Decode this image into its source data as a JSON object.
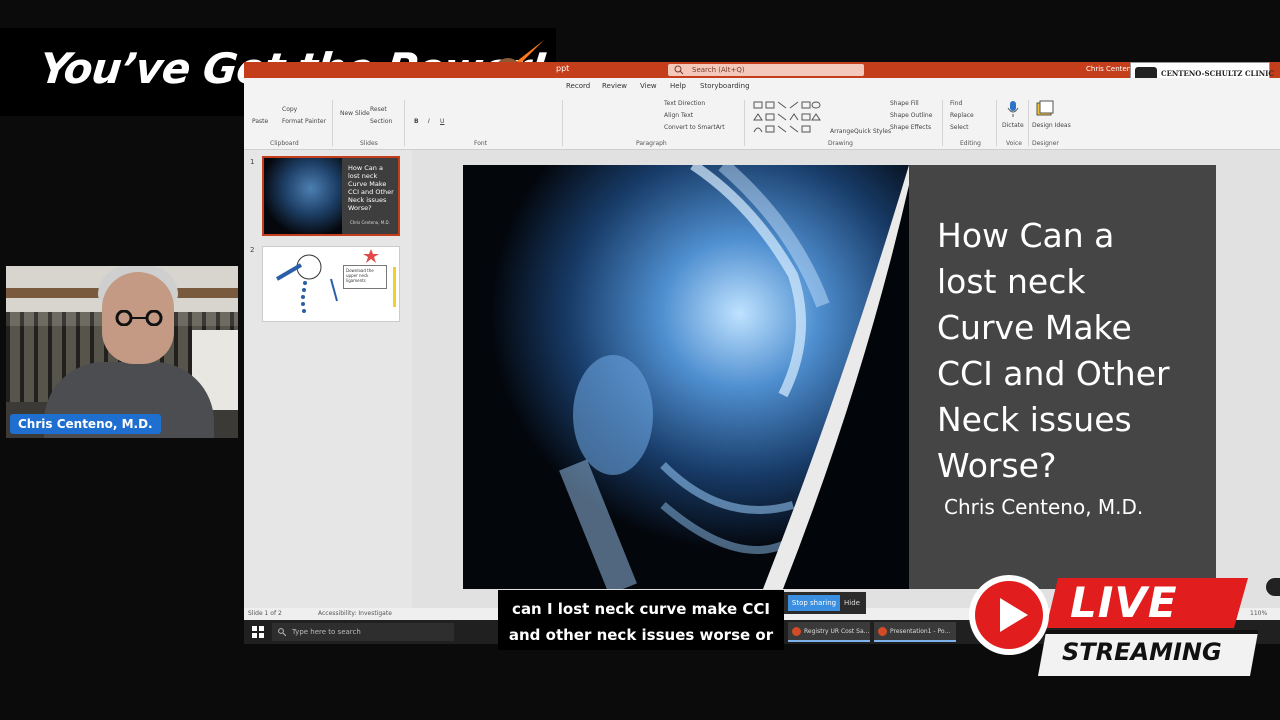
{
  "banner": {
    "title": "You’ve Got the Power!"
  },
  "webcam": {
    "name": "Chris Centeno, M.D."
  },
  "window": {
    "app_name": "ppt",
    "search_placeholder": "Search (Alt+Q)",
    "user": "Chris Centeno",
    "logo_text": "CENTENO-SCHULTZ CLINIC"
  },
  "tabs": [
    "Record",
    "Review",
    "View",
    "Help",
    "Storyboarding"
  ],
  "ribbon": {
    "paste": "Paste",
    "copy": "Copy",
    "format_painter": "Format Painter",
    "new_slide": "New Slide",
    "reset": "Reset",
    "section": "Section",
    "text_direction": "Text Direction",
    "align_text": "Align Text",
    "convert_smartart": "Convert to SmartArt",
    "arrange": "Arrange",
    "quick_styles": "Quick Styles",
    "shape_fill": "Shape Fill",
    "shape_outline": "Shape Outline",
    "shape_effects": "Shape Effects",
    "find": "Find",
    "replace": "Replace",
    "select": "Select",
    "dictate": "Dictate",
    "design_ideas": "Design Ideas",
    "groups": [
      "Clipboard",
      "Slides",
      "Font",
      "Paragraph",
      "Drawing",
      "Editing",
      "Voice",
      "Designer"
    ]
  },
  "thumbnails": [
    {
      "num": "1",
      "title": "How Can a\nlost neck\nCurve Make\nCCI and Other\nNeck issues\nWorse?",
      "author": "Chris Centeno, M.D."
    },
    {
      "num": "2",
      "box_text": "Download the upper neck ligaments"
    }
  ],
  "slide": {
    "title": "How Can a\nlost neck\nCurve Make\nCCI and Other\nNeck issues\nWorse?",
    "author": "Chris Centeno, M.D."
  },
  "statusbar": {
    "slide_info": "Slide 1 of 2",
    "accessibility": "Accessibility: Investigate",
    "zoom": "110%"
  },
  "share": {
    "stop": "Stop sharing",
    "hide": "Hide"
  },
  "taskbar": {
    "search_placeholder": "Type here to search",
    "apps": [
      "Registry UR Cost Sa...",
      "Presentation1 - Po..."
    ]
  },
  "captions": [
    "can I lost neck curve make CCI",
    "and other neck issues worse or"
  ],
  "live_badge": {
    "live": "LIVE",
    "streaming": "STREAMING"
  },
  "colors": {
    "ppt_accent": "#c43e1c",
    "live_red": "#e11d1d",
    "name_tag": "#1e6fd0"
  }
}
